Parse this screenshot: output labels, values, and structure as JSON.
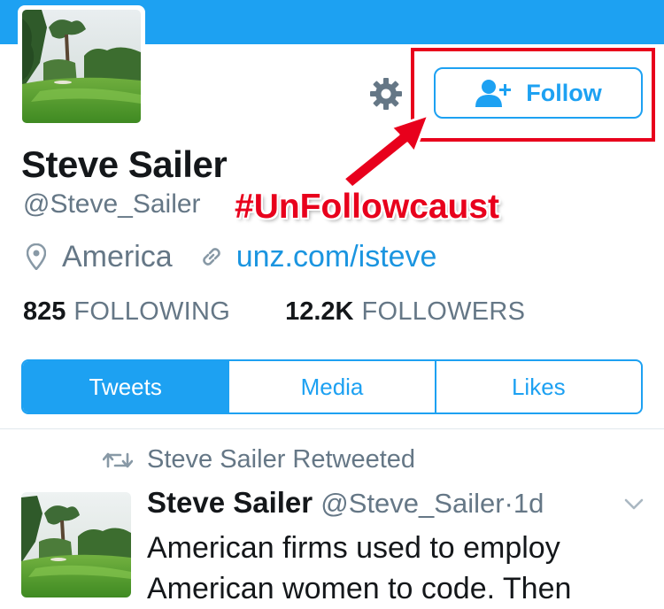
{
  "header": {
    "banner_color": "#1da1f2"
  },
  "profile": {
    "name": "Steve Sailer",
    "handle": "@Steve_Sailer",
    "location": "America",
    "link": "unz.com/isteve",
    "following_count": "825",
    "following_label": "FOLLOWING",
    "followers_count": "12.2K",
    "followers_label": "FOLLOWERS"
  },
  "actions": {
    "follow_label": "Follow",
    "settings_icon": "gear-icon",
    "follow_icon": "add-user-icon"
  },
  "annotation": {
    "hashtag": "#UnFollowcaust",
    "color": "#e8001c"
  },
  "tabs": [
    {
      "label": "Tweets",
      "active": true
    },
    {
      "label": "Media",
      "active": false
    },
    {
      "label": "Likes",
      "active": false
    }
  ],
  "tweet": {
    "retweet_label": "Steve Sailer Retweeted",
    "retweet_icon": "retweet-icon",
    "author_name": "Steve Sailer",
    "author_handle": "@Steve_Sailer",
    "separator": "·",
    "time": "1d",
    "text": "American firms used to employ American women to code. Then"
  },
  "colors": {
    "accent": "#1da1f2",
    "link": "#1b95e0",
    "secondary_text": "#657786",
    "highlight": "#e8001c"
  }
}
